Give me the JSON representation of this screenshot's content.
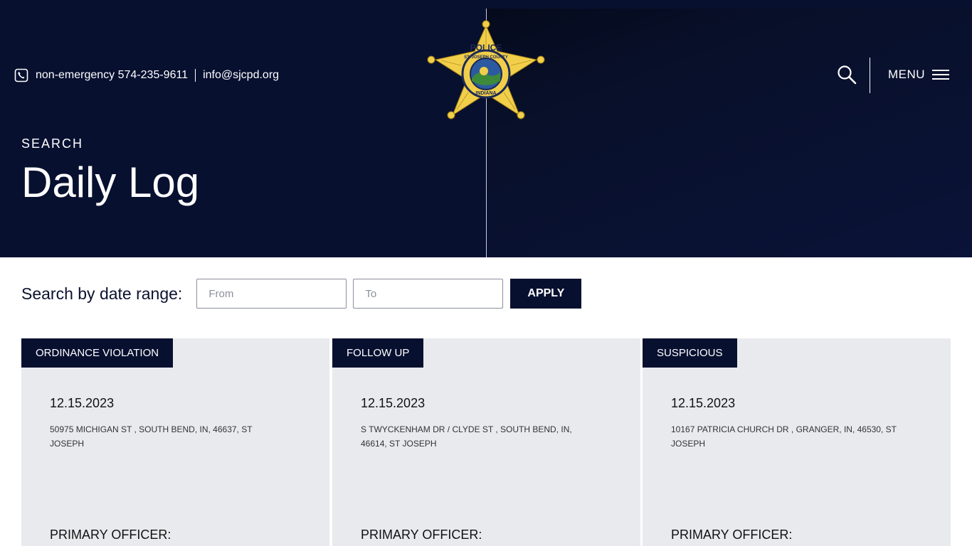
{
  "header": {
    "phone_text": "non-emergency 574-235-9611",
    "email_text": "info@sjcpd.org",
    "badge_top_text": "POLICE",
    "badge_ring_text": "ST. JOSEPH COUNTY",
    "badge_bottom_text": "INDIANA",
    "menu_label": "MENU"
  },
  "hero": {
    "eyebrow": "SEARCH",
    "title": "Daily Log"
  },
  "search": {
    "label": "Search by date range:",
    "from_placeholder": "From",
    "to_placeholder": "To",
    "apply_label": "APPLY"
  },
  "cards": [
    {
      "tag": "ORDINANCE VIOLATION",
      "date": "12.15.2023",
      "address": "50975 MICHIGAN ST , SOUTH BEND, IN, 46637, ST JOSEPH",
      "officer_label": "PRIMARY OFFICER:"
    },
    {
      "tag": "FOLLOW UP",
      "date": "12.15.2023",
      "address": "S TWYCKENHAM DR / CLYDE ST , SOUTH BEND, IN, 46614, ST JOSEPH",
      "officer_label": "PRIMARY OFFICER:"
    },
    {
      "tag": "SUSPICIOUS",
      "date": "12.15.2023",
      "address": "10167 PATRICIA CHURCH DR , GRANGER, IN, 46530, ST JOSEPH",
      "officer_label": "PRIMARY OFFICER:"
    }
  ],
  "colors": {
    "navy": "#081030",
    "badge_gold": "#f2cf4a",
    "card_bg": "#e8eaed"
  },
  "icons": [
    "phone-icon",
    "police-badge-logo",
    "search-icon",
    "hamburger-menu-icon"
  ]
}
